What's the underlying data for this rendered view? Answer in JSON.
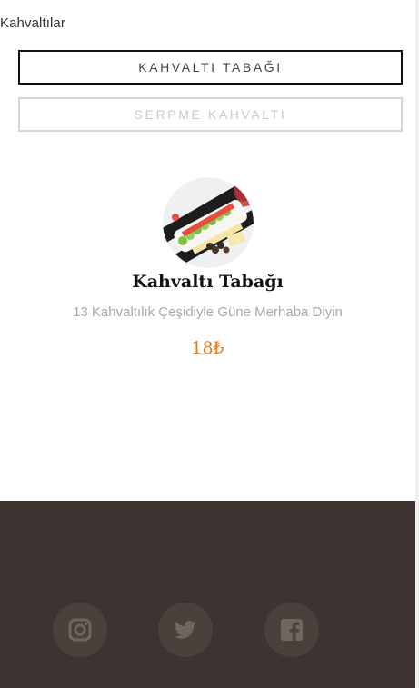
{
  "category": {
    "title": "Kahvaltılar"
  },
  "tabs": [
    {
      "label": "KAHVALTI TABAĞI",
      "active": true
    },
    {
      "label": "SERPME KAHVALTI",
      "active": false
    }
  ],
  "item": {
    "name": "Kahvaltı Tabağı",
    "description": "13 Kahvaltılık Çeşidiyle Güne Merhaba Diyin",
    "price": "18₺"
  },
  "footer": {
    "social": [
      {
        "icon": "instagram-icon"
      },
      {
        "icon": "twitter-icon"
      },
      {
        "icon": "facebook-icon"
      }
    ]
  },
  "colors": {
    "price": "#e8781c",
    "footer_bg": "#3d3431",
    "social_bg": "#4a413d",
    "social_icon": "#6f6561"
  }
}
